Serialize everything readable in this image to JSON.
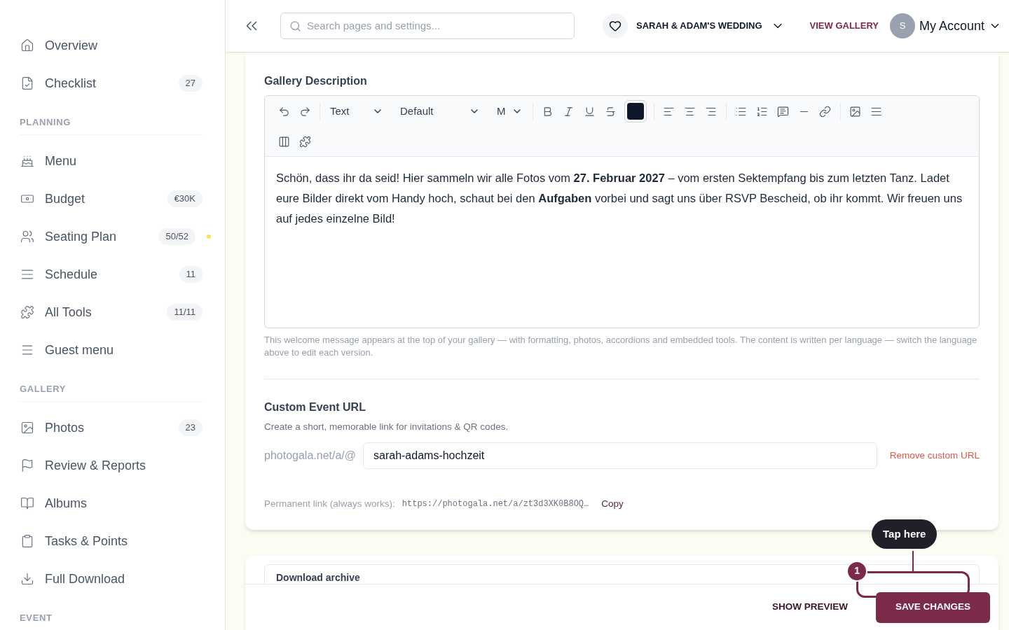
{
  "sidebar": {
    "sections": [
      {
        "items": [
          {
            "label": "Overview"
          },
          {
            "label": "Checklist",
            "badge": "27"
          }
        ]
      },
      {
        "heading": "PLANNING",
        "items": [
          {
            "label": "Menu"
          },
          {
            "label": "Budget",
            "badge": "€30K"
          },
          {
            "label": "Seating Plan",
            "badge": "50/52",
            "color": "#fde047"
          },
          {
            "label": "Schedule",
            "badge": "11"
          },
          {
            "label": "All Tools",
            "badge": "11/11"
          },
          {
            "label": "Guest menu"
          }
        ]
      },
      {
        "heading": "GALLERY",
        "items": [
          {
            "label": "Photos",
            "badge": "23"
          },
          {
            "label": "Review & Reports"
          },
          {
            "label": "Albums"
          },
          {
            "label": "Tasks & Points"
          },
          {
            "label": "Full Download"
          }
        ]
      },
      {
        "heading": "EVENT"
      }
    ]
  },
  "header": {
    "search": {
      "placeholder": "Search pages and settings..."
    },
    "event": "SARAH & ADAM'S WEDDING",
    "view_gallery": "VIEW GALLERY",
    "avatar": "S",
    "account": "My Account"
  },
  "description": {
    "label": "Gallery Description",
    "toolbar": {
      "block_type": "Text",
      "font": "Default",
      "size": "M"
    },
    "body": "Schön, dass ihr da seid! Hier sammeln wir alle Fotos vom **27. Februar 2027** – vom ersten Sektempfang bis zum letzten Tanz. Ladet eure Bilder direkt vom Handy hoch, schaut bei den **Aufgaben** vorbei und sagt uns über RSVP Bescheid, ob ihr kommt. Wir freuen uns auf jedes einzelne Bild!",
    "help": "This welcome message appears at the top of your gallery — with formatting, photos, accordions and embedded tools. The content is written per language — switch the language above to edit each version."
  },
  "custom_url": {
    "label": "Custom Event URL",
    "hint": "Create a short, memorable link for invitations & QR codes.",
    "prefix": "photogala.net/a/@",
    "value": "sarah-adams-hochzeit",
    "remove": "Remove custom URL",
    "permanent_label": "Permanent link (always works):",
    "permanent_link": "https://photogala.net/a/zt3d3XK0B8OQ…",
    "copy": "Copy"
  },
  "next_card": {
    "title": "Download archive"
  },
  "footer": {
    "preview": "SHOW PREVIEW",
    "save": "SAVE CHANGES"
  },
  "tour": {
    "step": "1",
    "tooltip": "Tap here"
  }
}
